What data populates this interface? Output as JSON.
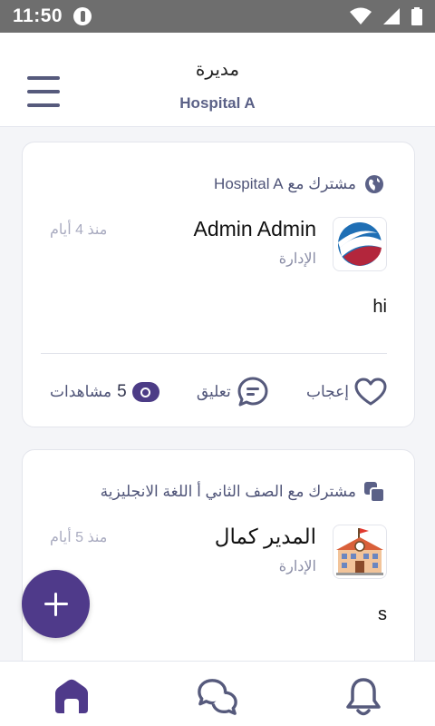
{
  "status_bar": {
    "time": "11:50"
  },
  "header": {
    "title": "مديرة",
    "subtitle": "Hospital A",
    "menu_icon": "hamburger-menu-icon"
  },
  "posts": [
    {
      "shared_with": "مشترك مع Hospital A",
      "shared_icon": "globe-icon",
      "author": "Admin Admin",
      "role": "الإدارة",
      "time": "منذ 4 أيام",
      "body": "hi",
      "avatar_icon": "hospital-logo",
      "actions": {
        "like": "إعجاب",
        "comment": "تعليق",
        "views_count": "5",
        "views_label": "مشاهدات"
      }
    },
    {
      "shared_with": "مشترك مع الصف الثاني أ اللغة الانجليزية",
      "shared_icon": "class-copy-icon",
      "author": "المدير كمال",
      "role": "الإدارة",
      "time": "منذ 5 أيام",
      "body": "s",
      "avatar_icon": "school-building-icon"
    }
  ],
  "fab": {
    "icon": "plus-icon"
  },
  "bottom_nav": {
    "items": [
      "home-icon",
      "chat-icon",
      "bell-icon"
    ],
    "active": "home-icon"
  },
  "colors": {
    "primary": "#4f3a8a",
    "icon": "#565a7c",
    "muted": "#8a8da6"
  }
}
